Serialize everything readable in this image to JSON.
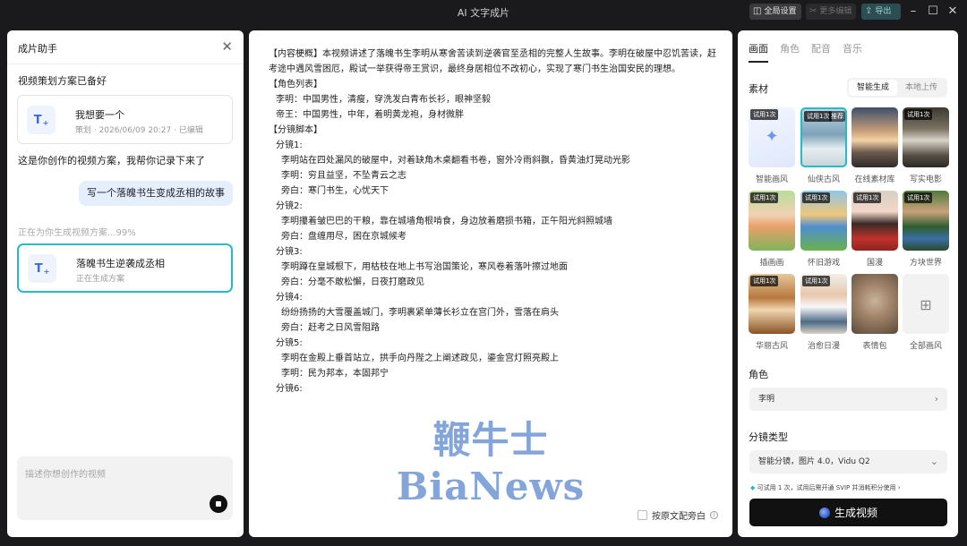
{
  "window": {
    "title": "AI 文字成片",
    "global_settings": "全局设置",
    "more_edit": "更多编辑",
    "export": "导出"
  },
  "left": {
    "header_title": "成片助手",
    "msg_ready": "视频策划方案已备好",
    "card1": {
      "name": "我想要一个",
      "sub": "策划 · 2026/06/09 20:27 · 已编辑"
    },
    "msg_recorded": "这是你创作的视频方案，我帮你记录下来了",
    "user_bubble": "写一个落魄书生变成丞相的故事",
    "progress": "正在为你生成视频方案...99%",
    "card2": {
      "name": "落魄书生逆袭成丞相",
      "sub": "正在生成方案"
    },
    "input_placeholder": "描述你想创作的视频"
  },
  "script": {
    "summary": "【内容梗概】本视频讲述了落魄书生李明从寒舍苦读到逆袭官至丞相的完整人生故事。李明在破屋中忍饥苦读，赶考途中遇风雪困厄，殿试一举获得帝王赏识，最终身居相位不改初心，实现了寒门书生治国安民的理想。",
    "roles_header": "【角色列表】",
    "role1": "李明：中国男性，清瘦，穿洗发白青布长衫，眼神坚毅",
    "role2": "帝王：中国男性，中年，着明黄龙袍，身材微胖",
    "shots_header": "【分镜脚本】",
    "shot1_title": "分镜1:",
    "shot1_a": "李明站在四处漏风的破屋中，对着缺角木桌翻看书卷，窗外冷雨斜飘，昏黄油灯晃动光影",
    "shot1_b": "李明：穷且益坚，不坠青云之志",
    "shot1_c": "旁白：寒门书生，心忧天下",
    "shot2_title": "分镜2:",
    "shot2_a": "李明攥着皱巴巴的干粮，靠在城墙角根啃食，身边放着磨损书箱，正午阳光斜照城墙",
    "shot2_b": "旁白：盘缠用尽，困在京城候考",
    "shot3_title": "分镜3:",
    "shot3_a": "李明蹲在皇城根下，用枯枝在地上书写治国策论，寒风卷着落叶擦过地面",
    "shot3_b": "旁白：分毫不敢松懈，日夜打磨政见",
    "shot4_title": "分镜4:",
    "shot4_a": "纷纷扬扬的大雪覆盖城门，李明裹紧单薄长衫立在宫门外，雪落在肩头",
    "shot4_b": "旁白：赶考之日风雪阻路",
    "shot5_title": "分镜5:",
    "shot5_a": "李明在金殿上垂首站立，拱手向丹陛之上阐述政见，鎏金宫灯照亮殿上",
    "shot5_b": "李明：民为邦本，本固邦宁",
    "shot6_title": "分镜6:",
    "voiceover_label": "按原文配旁白",
    "watermark": "鞭牛士 BiaNews"
  },
  "right": {
    "tabs": [
      "画面",
      "角色",
      "配音",
      "音乐"
    ],
    "material_label": "素材",
    "seg_smart": "智能生成",
    "seg_local": "本地上传",
    "badge_trial": "试用1次",
    "badge_hot": "推荐",
    "styles": [
      "智能画风",
      "仙侠古风",
      "在线素材库",
      "写实电影",
      "插画画",
      "怀旧游戏",
      "国漫",
      "方块世界",
      "华丽古风",
      "治愈日漫",
      "表情包",
      "全部画风"
    ],
    "role_label": "角色",
    "role_value": "李明",
    "shot_type_label": "分镜类型",
    "shot_type_value": "智能分镜，图片 4.0，Vidu Q2",
    "trial_note": "可试用 1 次，试用后需开通 SVIP 并消耗积分使用",
    "generate_button": "生成视频"
  }
}
